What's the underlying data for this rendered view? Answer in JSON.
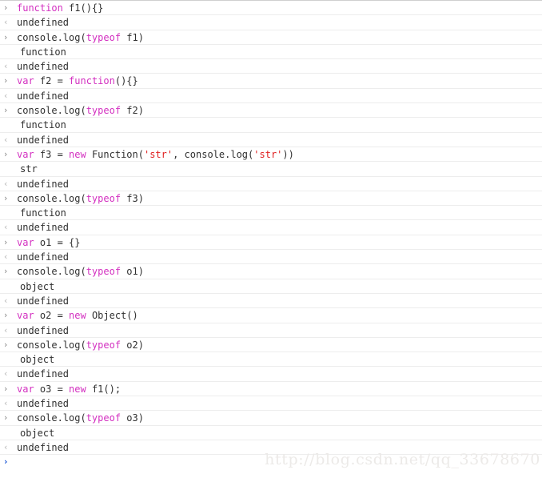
{
  "panel": {
    "name": "devtools-console",
    "background_color": "#ffffff",
    "divider_color": "#ededed",
    "top_border_color": "#cfcfcf"
  },
  "glyphs": {
    "input_arrow": "›",
    "output_arrow": "‹",
    "active_arrow": "›"
  },
  "colors": {
    "keyword": "#d330c0",
    "string": "#e02020",
    "plain_text": "#303030",
    "result_text": "#9a9a9a",
    "input_arrow": "#8a8a8a",
    "output_arrow": "#b9b9b9",
    "active_arrow": "#2a62d8",
    "watermark": "#eceae8"
  },
  "watermark": {
    "text": "http://blog.csdn.net/qq_33678670"
  },
  "rows": [
    {
      "kind": "input",
      "tokens": [
        {
          "t": "kw",
          "v": "function"
        },
        {
          "t": "pln",
          "v": " f1(){}"
        }
      ]
    },
    {
      "kind": "result",
      "tokens": [
        {
          "t": "res",
          "v": "undefined"
        }
      ]
    },
    {
      "kind": "input",
      "tokens": [
        {
          "t": "pln",
          "v": "console.log("
        },
        {
          "t": "kw",
          "v": "typeof"
        },
        {
          "t": "pln",
          "v": " f1)"
        }
      ]
    },
    {
      "kind": "log",
      "tokens": [
        {
          "t": "pln",
          "v": "function"
        }
      ]
    },
    {
      "kind": "result",
      "tokens": [
        {
          "t": "res",
          "v": "undefined"
        }
      ]
    },
    {
      "kind": "input",
      "tokens": [
        {
          "t": "kw",
          "v": "var"
        },
        {
          "t": "pln",
          "v": " f2 = "
        },
        {
          "t": "kw",
          "v": "function"
        },
        {
          "t": "pln",
          "v": "(){}"
        }
      ]
    },
    {
      "kind": "result",
      "tokens": [
        {
          "t": "res",
          "v": "undefined"
        }
      ]
    },
    {
      "kind": "input",
      "tokens": [
        {
          "t": "pln",
          "v": "console.log("
        },
        {
          "t": "kw",
          "v": "typeof"
        },
        {
          "t": "pln",
          "v": " f2)"
        }
      ]
    },
    {
      "kind": "log",
      "tokens": [
        {
          "t": "pln",
          "v": "function"
        }
      ]
    },
    {
      "kind": "result",
      "tokens": [
        {
          "t": "res",
          "v": "undefined"
        }
      ]
    },
    {
      "kind": "input",
      "tokens": [
        {
          "t": "kw",
          "v": "var"
        },
        {
          "t": "pln",
          "v": " f3 = "
        },
        {
          "t": "kw",
          "v": "new"
        },
        {
          "t": "pln",
          "v": " Function("
        },
        {
          "t": "str",
          "v": "'str'"
        },
        {
          "t": "pln",
          "v": ", console.log("
        },
        {
          "t": "str",
          "v": "'str'"
        },
        {
          "t": "pln",
          "v": "))"
        }
      ]
    },
    {
      "kind": "log",
      "tokens": [
        {
          "t": "pln",
          "v": "str"
        }
      ]
    },
    {
      "kind": "result",
      "tokens": [
        {
          "t": "res",
          "v": "undefined"
        }
      ]
    },
    {
      "kind": "input",
      "tokens": [
        {
          "t": "pln",
          "v": "console.log("
        },
        {
          "t": "kw",
          "v": "typeof"
        },
        {
          "t": "pln",
          "v": " f3)"
        }
      ]
    },
    {
      "kind": "log",
      "tokens": [
        {
          "t": "pln",
          "v": "function"
        }
      ]
    },
    {
      "kind": "result",
      "tokens": [
        {
          "t": "res",
          "v": "undefined"
        }
      ]
    },
    {
      "kind": "input",
      "tokens": [
        {
          "t": "kw",
          "v": "var"
        },
        {
          "t": "pln",
          "v": " o1 = {}"
        }
      ]
    },
    {
      "kind": "result",
      "tokens": [
        {
          "t": "res",
          "v": "undefined"
        }
      ]
    },
    {
      "kind": "input",
      "tokens": [
        {
          "t": "pln",
          "v": "console.log("
        },
        {
          "t": "kw",
          "v": "typeof"
        },
        {
          "t": "pln",
          "v": " o1)"
        }
      ]
    },
    {
      "kind": "log",
      "tokens": [
        {
          "t": "pln",
          "v": "object"
        }
      ]
    },
    {
      "kind": "result",
      "tokens": [
        {
          "t": "res",
          "v": "undefined"
        }
      ]
    },
    {
      "kind": "input",
      "tokens": [
        {
          "t": "kw",
          "v": "var"
        },
        {
          "t": "pln",
          "v": " o2 = "
        },
        {
          "t": "kw",
          "v": "new"
        },
        {
          "t": "pln",
          "v": " Object()"
        }
      ]
    },
    {
      "kind": "result",
      "tokens": [
        {
          "t": "res",
          "v": "undefined"
        }
      ]
    },
    {
      "kind": "input",
      "tokens": [
        {
          "t": "pln",
          "v": "console.log("
        },
        {
          "t": "kw",
          "v": "typeof"
        },
        {
          "t": "pln",
          "v": " o2)"
        }
      ]
    },
    {
      "kind": "log",
      "tokens": [
        {
          "t": "pln",
          "v": "object"
        }
      ]
    },
    {
      "kind": "result",
      "tokens": [
        {
          "t": "res",
          "v": "undefined"
        }
      ]
    },
    {
      "kind": "input",
      "tokens": [
        {
          "t": "kw",
          "v": "var"
        },
        {
          "t": "pln",
          "v": " o3 = "
        },
        {
          "t": "kw",
          "v": "new"
        },
        {
          "t": "pln",
          "v": " f1();"
        }
      ]
    },
    {
      "kind": "result",
      "tokens": [
        {
          "t": "res",
          "v": "undefined"
        }
      ]
    },
    {
      "kind": "input",
      "tokens": [
        {
          "t": "pln",
          "v": "console.log("
        },
        {
          "t": "kw",
          "v": "typeof"
        },
        {
          "t": "pln",
          "v": " o3)"
        }
      ]
    },
    {
      "kind": "log",
      "tokens": [
        {
          "t": "pln",
          "v": "object"
        }
      ]
    },
    {
      "kind": "result",
      "tokens": [
        {
          "t": "res",
          "v": "undefined"
        }
      ]
    }
  ],
  "active_prompt": {
    "value": "",
    "placeholder": ""
  }
}
